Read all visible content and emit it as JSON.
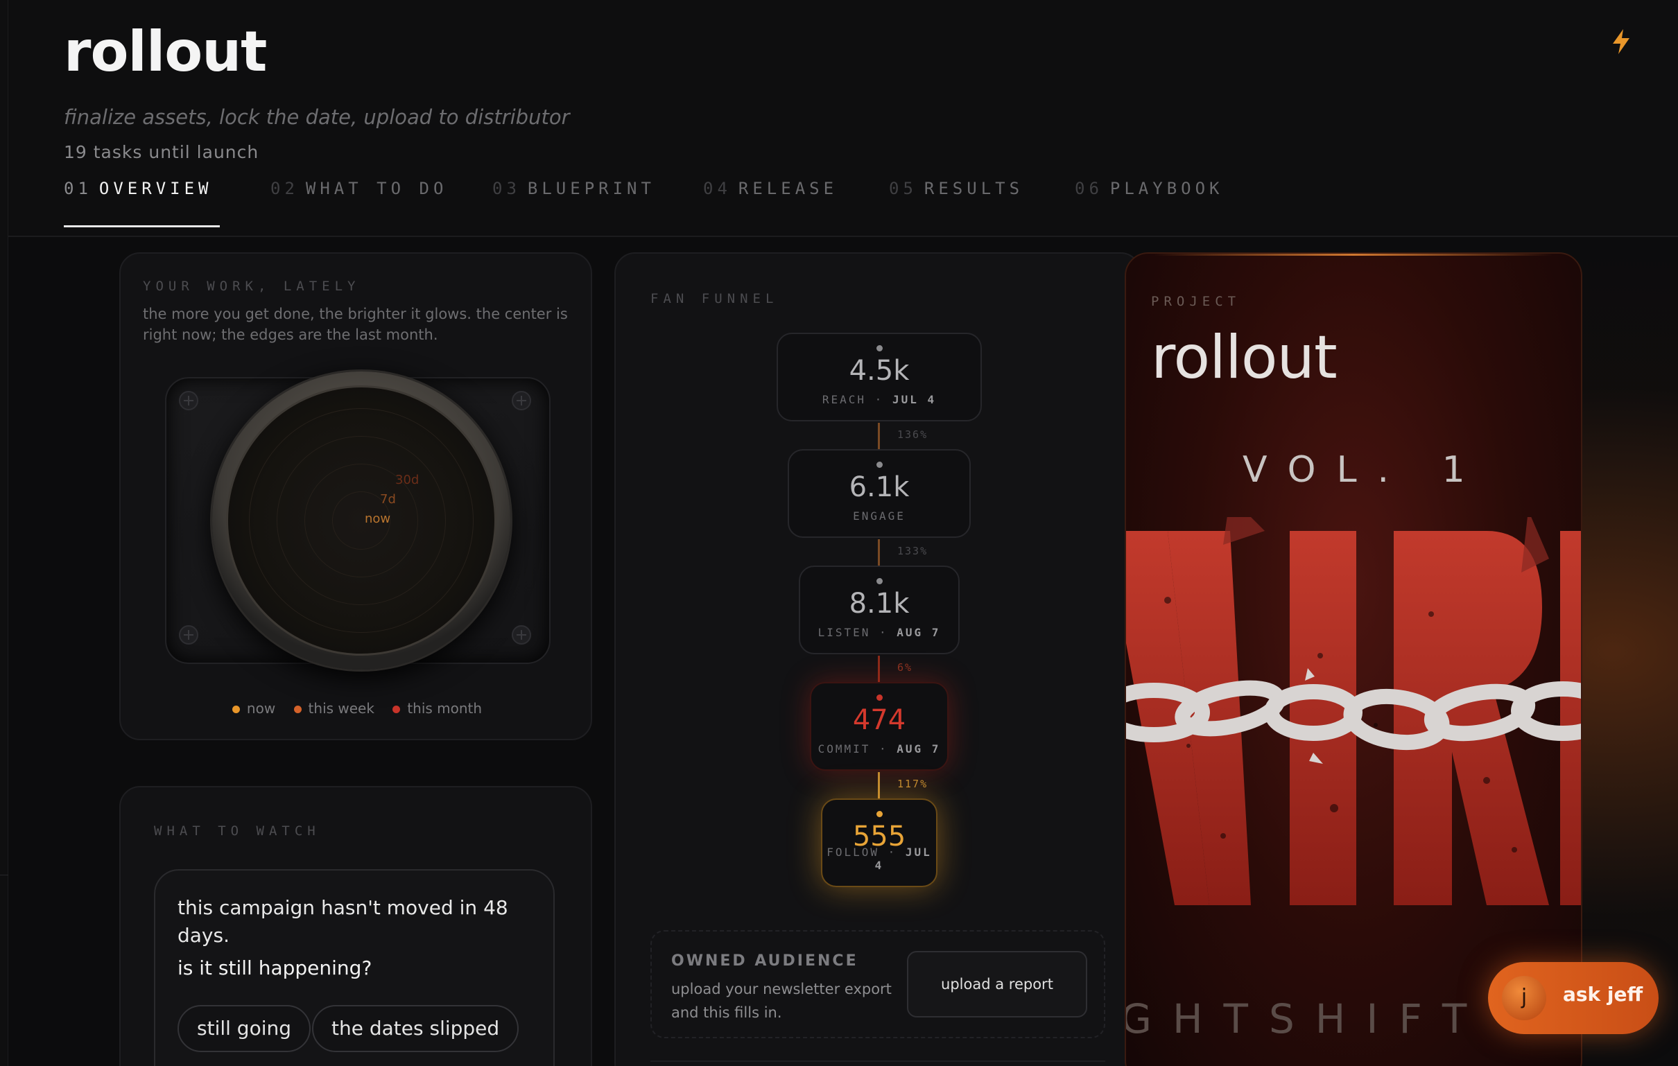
{
  "app": {
    "title": "rollout",
    "subtitle": "finalize assets, lock the date, upload to distributor",
    "tasks_left": "19 tasks until launch"
  },
  "tabs": [
    {
      "num": "01",
      "label": "OVERVIEW",
      "active": true
    },
    {
      "num": "02",
      "label": "WHAT TO DO",
      "active": false
    },
    {
      "num": "03",
      "label": "BLUEPRINT",
      "active": false
    },
    {
      "num": "04",
      "label": "RELEASE",
      "active": false
    },
    {
      "num": "05",
      "label": "RESULTS",
      "active": false
    },
    {
      "num": "06",
      "label": "PLAYBOOK",
      "active": false
    }
  ],
  "work": {
    "eyebrow": "YOUR WORK, LATELY",
    "description": "the more you get done, the brighter it glows. the center is right now; the edges are the last month.",
    "ring_labels": {
      "r30": "30d",
      "r7": "7d",
      "now": "now"
    },
    "legend": [
      {
        "label": "now",
        "color": "#e8962a"
      },
      {
        "label": "this week",
        "color": "#d4622a"
      },
      {
        "label": "this month",
        "color": "#c8342a"
      }
    ]
  },
  "watch": {
    "eyebrow": "WHAT TO WATCH",
    "message": "this campaign hasn't moved in 48 days.",
    "question": "is it still happening?",
    "options": [
      "still going",
      "the dates slipped"
    ]
  },
  "funnel": {
    "eyebrow": "FAN FUNNEL",
    "stages": [
      {
        "value": "4.5k",
        "label": "REACH",
        "date": "JUL 4"
      },
      {
        "value": "6.1k",
        "label": "ENGAGE",
        "date": ""
      },
      {
        "value": "8.1k",
        "label": "LISTEN",
        "date": "AUG 7"
      },
      {
        "value": "474",
        "label": "COMMIT",
        "date": "AUG 7"
      },
      {
        "value": "555",
        "label": "FOLLOW",
        "date": "JUL 4"
      }
    ],
    "rates": [
      "136%",
      "133%",
      "6%",
      "117%"
    ],
    "owned": {
      "heading": "OWNED AUDIENCE",
      "text": "upload your newsletter export and this fills in.",
      "button": "upload a report"
    }
  },
  "cover": {
    "eyebrow": "PROJECT",
    "title": "rollout",
    "volume": "VOL. 1",
    "artist_partial": "GHTSHIFT W"
  },
  "assistant": {
    "avatar_letter": "j",
    "label": "ask jeff"
  },
  "colors": {
    "accent": "#e8962a",
    "commit_red": "#d4392d",
    "follow_amber": "#e8a437"
  }
}
